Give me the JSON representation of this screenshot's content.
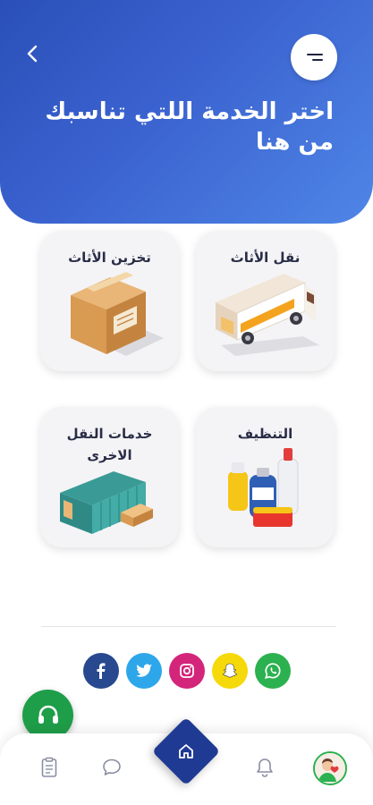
{
  "header": {
    "title": "اختر الخدمة اللتي تناسبك من هنا",
    "back_icon": "chevron-left-icon",
    "menu_icon": "menu-icon"
  },
  "services": [
    {
      "label": "نقل الأثاث",
      "icon": "moving-truck-illustration"
    },
    {
      "label": "تخزين الأثاث",
      "icon": "cardboard-box-illustration"
    },
    {
      "label": "التنظيف",
      "icon": "cleaning-supplies-illustration"
    },
    {
      "label": "خدمات النقل الاخرى",
      "icon": "shipping-container-illustration"
    }
  ],
  "social": [
    {
      "name": "whatsapp",
      "color": "#2bb14f"
    },
    {
      "name": "snapchat",
      "color": "#f5d90a"
    },
    {
      "name": "instagram",
      "color": "#d3257a"
    },
    {
      "name": "twitter",
      "color": "#2ea6ea"
    },
    {
      "name": "facebook",
      "color": "#28498f"
    }
  ],
  "bottom_nav": {
    "items": [
      "orders-icon",
      "chat-icon",
      "home-icon",
      "bell-icon",
      "profile-avatar"
    ],
    "active": "home-icon"
  },
  "colors": {
    "primary": "#2a4fb8",
    "home_button": "#1f3a93",
    "support": "#1f9e49"
  }
}
